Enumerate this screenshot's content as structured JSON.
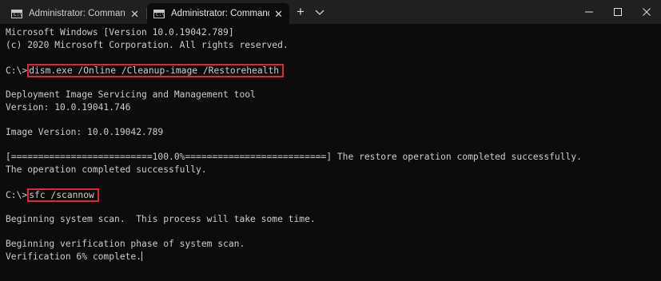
{
  "window": {
    "tabs": [
      {
        "title": "Administrator: Command Promp",
        "icon": "cmd-icon",
        "active": false
      },
      {
        "title": "Administrator: Command Promp",
        "icon": "cmd-icon",
        "active": true
      }
    ],
    "tab_icon_text": "C:\\",
    "close_glyph": "✕",
    "new_tab_glyph": "+"
  },
  "terminal": {
    "lines": [
      "Microsoft Windows [Version 10.0.19042.789]",
      "(c) 2020 Microsoft Corporation. All rights reserved.",
      "",
      "",
      "",
      "Deployment Image Servicing and Management tool",
      "Version: 10.0.19041.746",
      "",
      "Image Version: 10.0.19042.789",
      "",
      "[==========================100.0%==========================] The restore operation completed successfully.",
      "The operation completed successfully.",
      "",
      "",
      "",
      "Beginning system scan.  This process will take some time.",
      "",
      "Beginning verification phase of system scan."
    ],
    "prompt": "C:\\>",
    "command1": "dism.exe /Online /Cleanup-image /Restorehealth",
    "command2": "sfc /scannow",
    "last_line": "Verification 6% complete.",
    "highlight_color": "#e0262e"
  }
}
